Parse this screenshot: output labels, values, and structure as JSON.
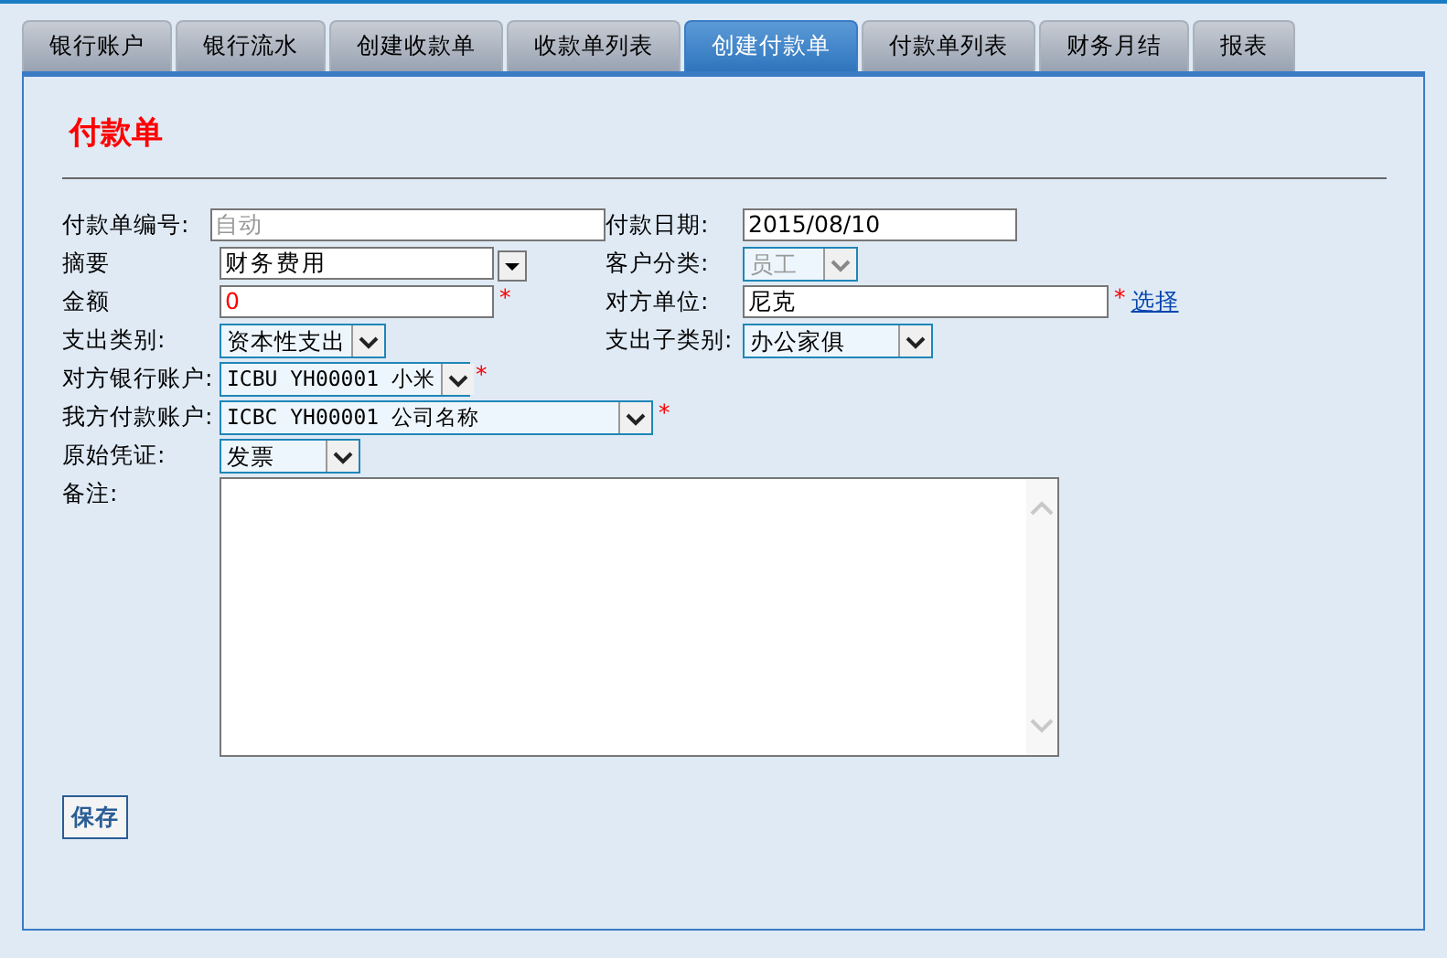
{
  "tabs": [
    {
      "label": "银行账户",
      "selected": false
    },
    {
      "label": "银行流水",
      "selected": false
    },
    {
      "label": "创建收款单",
      "selected": false
    },
    {
      "label": "收款单列表",
      "selected": false
    },
    {
      "label": "创建付款单",
      "selected": true
    },
    {
      "label": "付款单列表",
      "selected": false
    },
    {
      "label": "财务月结",
      "selected": false
    },
    {
      "label": "报表",
      "selected": false
    }
  ],
  "form": {
    "title": "付款单",
    "rows": [
      [
        {
          "label": "付款单编号:",
          "kind": "text",
          "value": "自动",
          "disabled": true,
          "invalid": false
        },
        {
          "label": "付款日期:",
          "kind": "text",
          "value": "2015/08/10",
          "disabled": false,
          "invalid": false
        }
      ],
      [
        {
          "label": "摘要",
          "kind": "combo",
          "value": "财务费用",
          "disabled": false,
          "invalid": false
        },
        {
          "label": "客户分类:",
          "kind": "select",
          "value": "员工",
          "disabled": true,
          "invalid": false
        }
      ],
      [
        {
          "label": "金额",
          "kind": "text",
          "value": "0",
          "required_mark": "*",
          "disabled": false,
          "invalid": true
        },
        {
          "label": "对方单位:",
          "kind": "text",
          "value": "尼克",
          "required_mark": "*",
          "disabled": false,
          "invalid": false,
          "link": "选择"
        }
      ],
      [
        {
          "label": "支出类别:",
          "kind": "select",
          "value": "资本性支出",
          "disabled": false,
          "invalid": false
        },
        {
          "label": "支出子类别:",
          "kind": "select",
          "value": "办公家俱",
          "disabled": false,
          "invalid": false
        }
      ],
      [
        {
          "label": "对方银行账户:",
          "kind": "select",
          "value": "ICBU YH00001 小米",
          "required_mark": "*",
          "disabled": false,
          "invalid": false
        }
      ],
      [
        {
          "label": "我方付款账户:",
          "kind": "select",
          "value": "ICBC YH00001 公司名称",
          "required_mark": "*",
          "disabled": false,
          "invalid": false
        }
      ],
      [
        {
          "label": "原始凭证:",
          "kind": "select",
          "value": "发票",
          "disabled": false,
          "invalid": false
        }
      ],
      [
        {
          "label": "备注:",
          "kind": "textarea",
          "disabled": false,
          "invalid": false
        }
      ]
    ],
    "save_button": "保存"
  }
}
